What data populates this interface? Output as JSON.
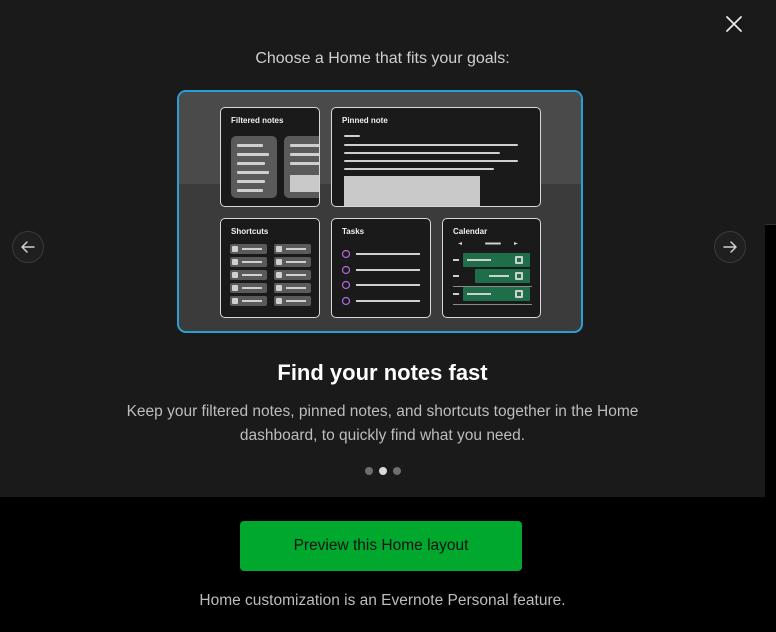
{
  "header": {
    "prompt": "Choose a Home that fits your goals:"
  },
  "preview_cards": {
    "filtered": "Filtered notes",
    "pinned": "Pinned note",
    "shortcuts": "Shortcuts",
    "tasks": "Tasks",
    "calendar": "Calendar"
  },
  "slide": {
    "title": "Find your notes fast",
    "description": "Keep your filtered notes, pinned notes, and shortcuts together in the Home dashboard, to quickly find what you need."
  },
  "pagination": {
    "current": 2,
    "total": 3
  },
  "cta": {
    "label": "Preview this Home layout"
  },
  "footer": {
    "note": "Home customization is an Evernote Personal feature."
  },
  "colors": {
    "accent_green": "#00a82d",
    "selection_blue": "#2a9fd6",
    "task_circle": "#b06ad9",
    "calendar_green": "#1f6e4a"
  }
}
